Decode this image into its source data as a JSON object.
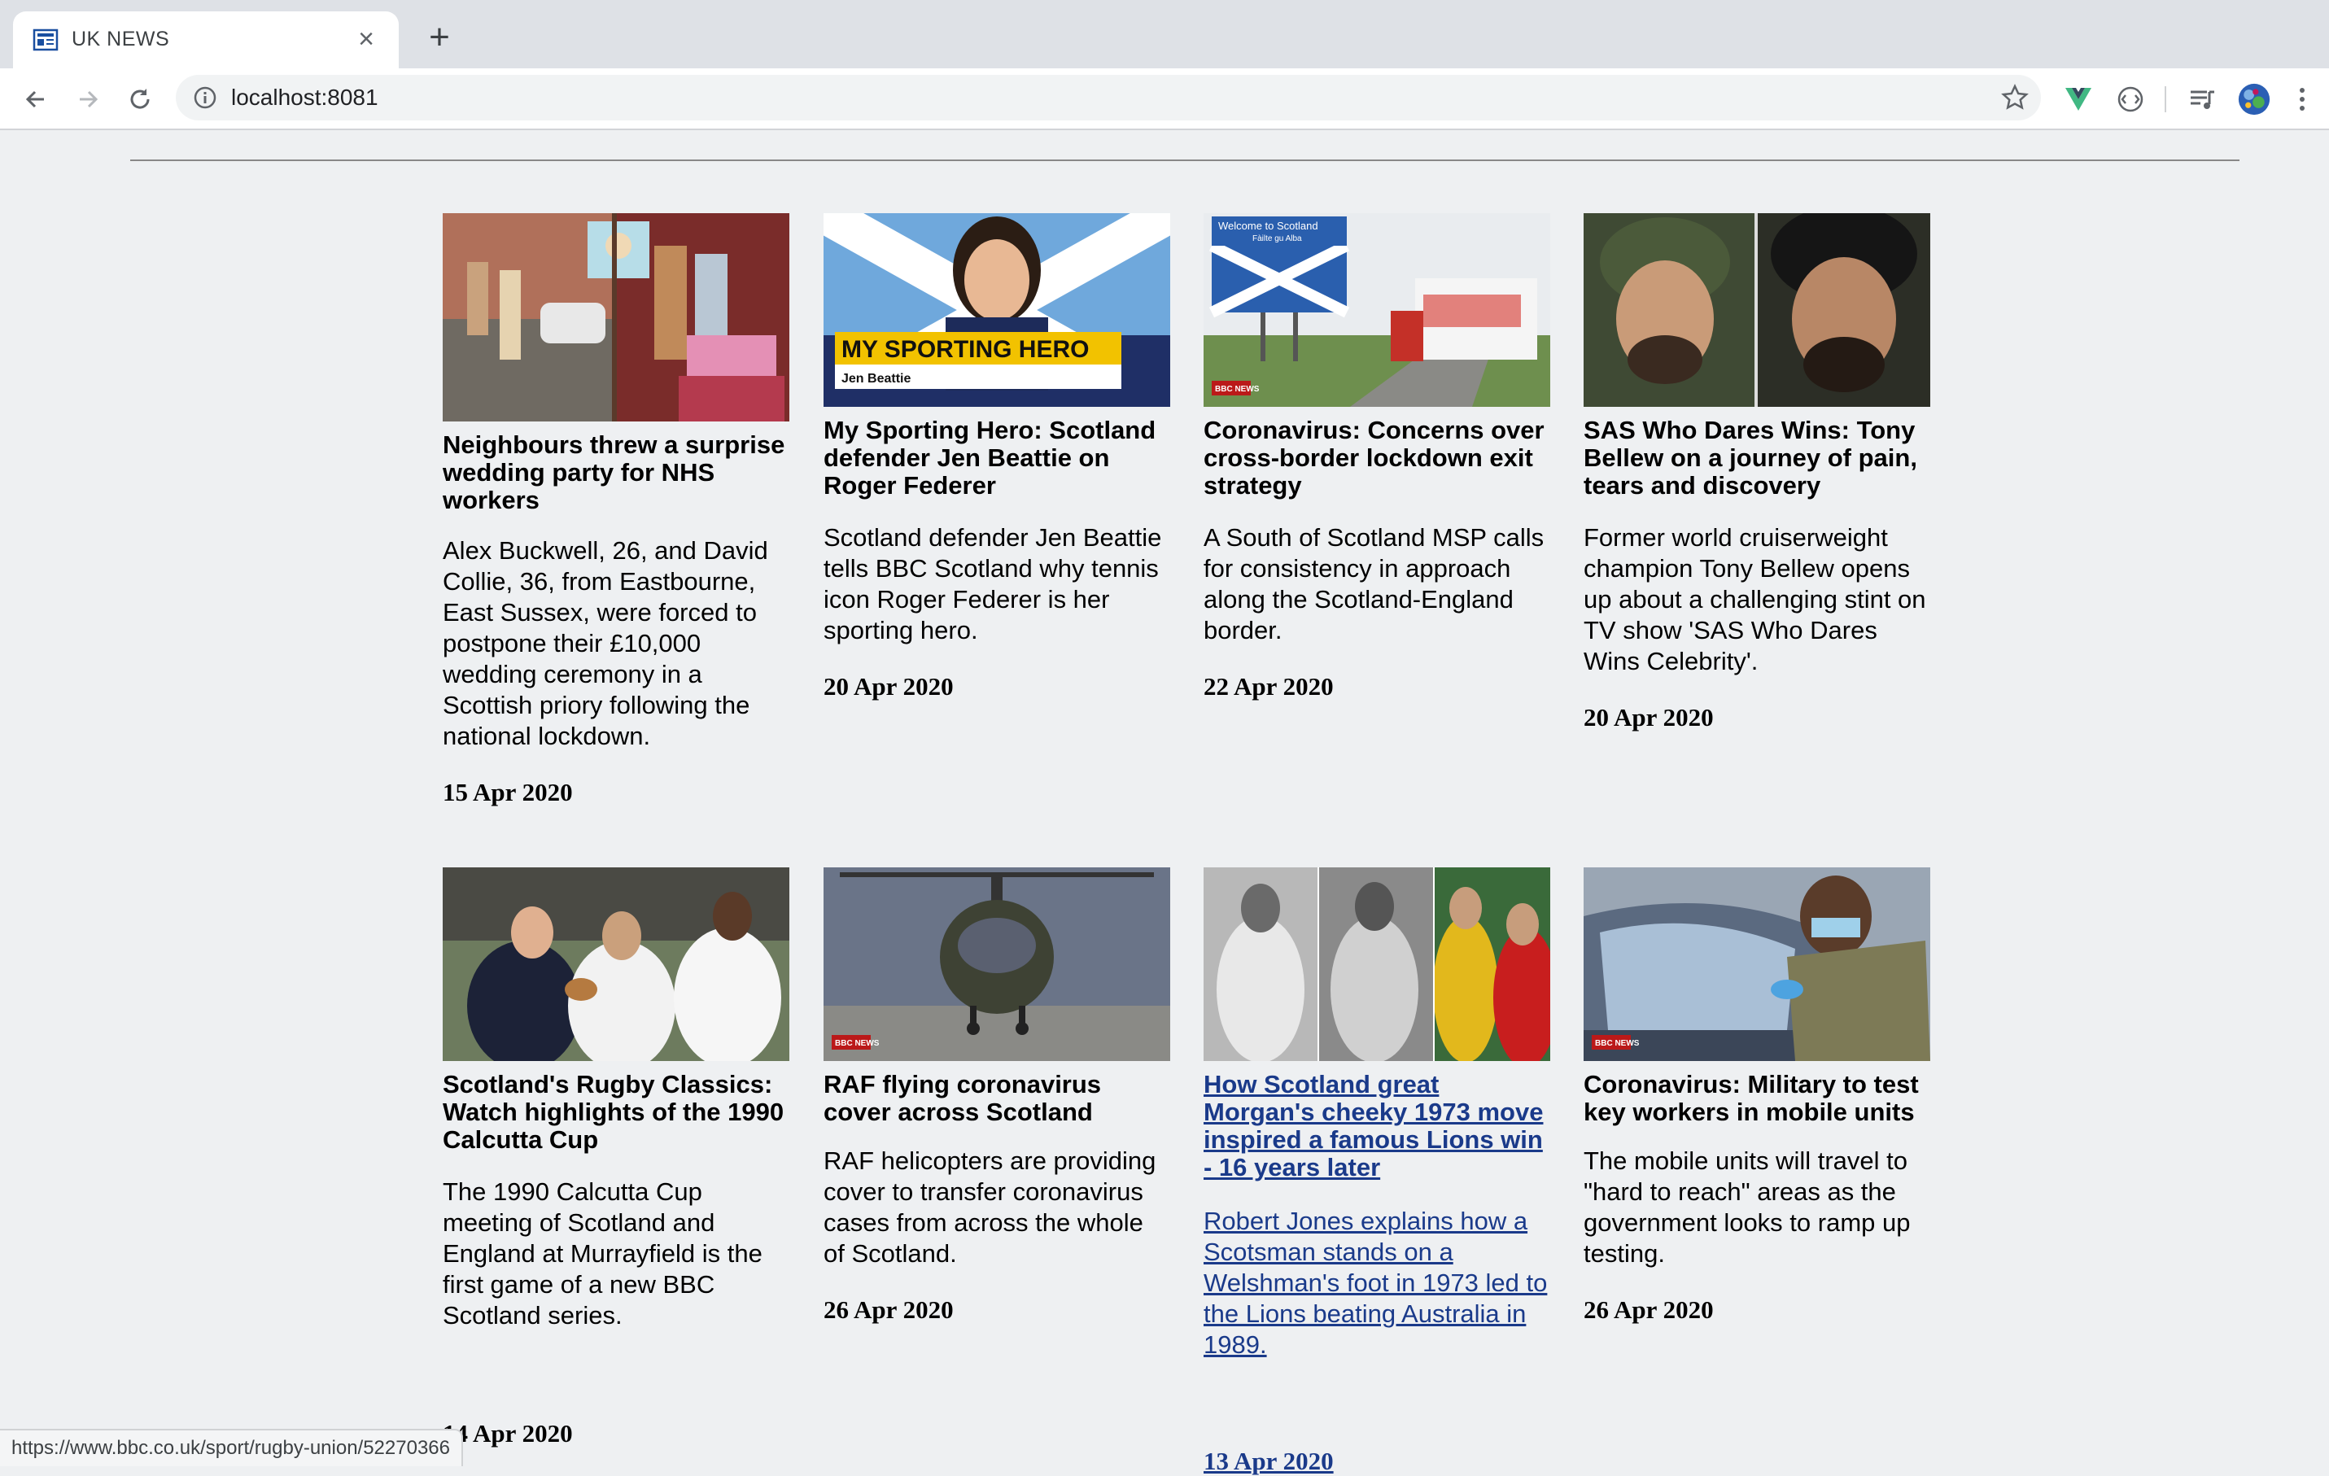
{
  "browser": {
    "tab_title": "UK NEWS",
    "url": "localhost:8081",
    "status_url": "https://www.bbc.co.uk/sport/rugby-union/52270366",
    "icons": [
      "newspaper-favicon-icon",
      "close-icon",
      "plus-icon",
      "back-icon",
      "forward-icon",
      "reload-icon",
      "info-icon",
      "star-icon",
      "vue-extension-icon",
      "extension-icon",
      "media-control-icon",
      "profile-avatar-icon",
      "more-menu-icon"
    ]
  },
  "articles": [
    {
      "headline": "Neighbours threw a surprise wedding party for NHS workers",
      "summary": "Alex Buckwell, 26, and David Collie, 36, from Eastbourne, East Sussex, were forced to postpone their £10,000 wedding ceremony in a Scottish priory following the national lockdown.",
      "date": "15 Apr 2020"
    },
    {
      "headline": "My Sporting Hero: Scotland defender Jen Beattie on Roger Federer",
      "summary": "Scotland defender Jen Beattie tells BBC Scotland why tennis icon Roger Federer is her sporting hero.",
      "date": "20 Apr 2020",
      "image_caption": "MY SPORTING HERO",
      "image_subcaption": "Jen Beattie"
    },
    {
      "headline": "Coronavirus: Concerns over cross-border lockdown exit strategy",
      "summary": "A South of Scotland MSP calls for consistency in approach along the Scotland-England border.",
      "date": "22 Apr 2020",
      "image_sign": "Welcome to Scotland",
      "image_sign_sub": "Fàilte gu Alba",
      "image_badge": "BBC NEWS"
    },
    {
      "headline": "SAS Who Dares Wins: Tony Bellew on a journey of pain, tears and discovery",
      "summary": "Former world cruiserweight champion Tony Bellew opens up about a challenging stint on TV show 'SAS Who Dares Wins Celebrity'.",
      "date": "20 Apr 2020"
    },
    {
      "headline": "Scotland's Rugby Classics: Watch highlights of the 1990 Calcutta Cup",
      "summary": "The 1990 Calcutta Cup meeting of Scotland and England at Murrayfield is the first game of a new BBC Scotland series.",
      "date": "14 Apr 2020"
    },
    {
      "headline": "RAF flying coronavirus cover across Scotland",
      "summary": "RAF helicopters are providing cover to transfer coronavirus cases from across the whole of Scotland.",
      "date": "26 Apr 2020",
      "image_badge": "BBC NEWS"
    },
    {
      "headline": "How Scotland great Morgan's cheeky 1973 move inspired a famous Lions win - 16 years later",
      "summary": "Robert Jones explains how a Scotsman stands on a Welshman's foot in 1973 led to the Lions beating Australia in 1989.",
      "date": "13 Apr 2020"
    },
    {
      "headline": "Coronavirus: Military to test key workers in mobile units",
      "summary": "The mobile units will travel to \"hard to reach\" areas as the government looks to ramp up testing.",
      "date": "26 Apr 2020",
      "image_badge": "BBC NEWS"
    }
  ]
}
